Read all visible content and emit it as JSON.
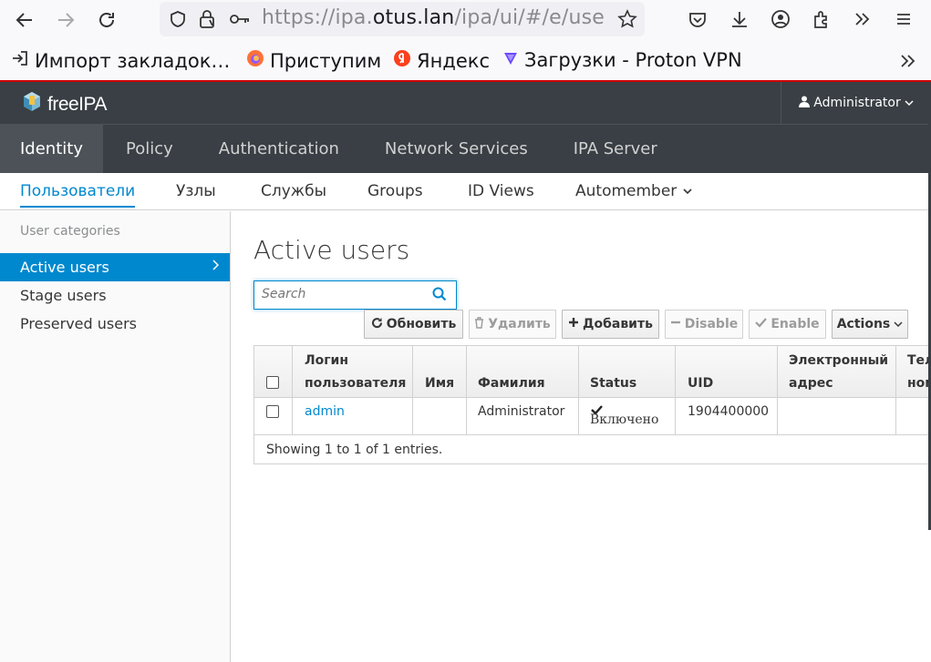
{
  "browser": {
    "url_prefix": "https://ipa.",
    "url_host": "otus.lan",
    "url_suffix": "/ipa/ui/#/e/use",
    "bookmarks": [
      {
        "label": "Импорт закладок…",
        "icon": "import-icon"
      },
      {
        "label": "Приступим",
        "icon": "firefox-icon"
      },
      {
        "label": "Яндекс",
        "icon": "yandex-icon"
      },
      {
        "label": "Загрузки - Proton VPN",
        "icon": "proton-icon"
      }
    ]
  },
  "header": {
    "brand": "freeIPA",
    "user": "Administrator"
  },
  "main_nav": [
    {
      "label": "Identity",
      "active": true
    },
    {
      "label": "Policy"
    },
    {
      "label": "Authentication"
    },
    {
      "label": "Network Services"
    },
    {
      "label": "IPA Server"
    }
  ],
  "sub_nav": [
    {
      "label": "Пользователи",
      "active": true
    },
    {
      "label": "Узлы"
    },
    {
      "label": "Службы"
    },
    {
      "label": "Groups"
    },
    {
      "label": "ID Views"
    },
    {
      "label": "Automember"
    }
  ],
  "sidebar": {
    "heading": "User categories",
    "items": [
      {
        "label": "Active users",
        "active": true
      },
      {
        "label": "Stage users"
      },
      {
        "label": "Preserved users"
      }
    ]
  },
  "page": {
    "title": "Active users",
    "search_placeholder": "Search",
    "buttons": {
      "refresh": "Обновить",
      "delete": "Удалить",
      "add": "Добавить",
      "disable": "Disable",
      "enable": "Enable",
      "actions": "Actions"
    }
  },
  "table": {
    "headers": {
      "login_1": "Логин",
      "login_2": "пользователя",
      "first": "Имя",
      "last": "Фамилия",
      "status": "Status",
      "uid": "UID",
      "email_1": "Электронный",
      "email_2": "адрес",
      "phone_1": "Теле",
      "phone_2": "ном"
    },
    "rows": [
      {
        "login": "admin",
        "first": "",
        "last": "Administrator",
        "status": "Включено",
        "uid": "1904400000",
        "email": "",
        "phone": ""
      }
    ],
    "footer": "Showing 1 to 1 of 1 entries."
  }
}
